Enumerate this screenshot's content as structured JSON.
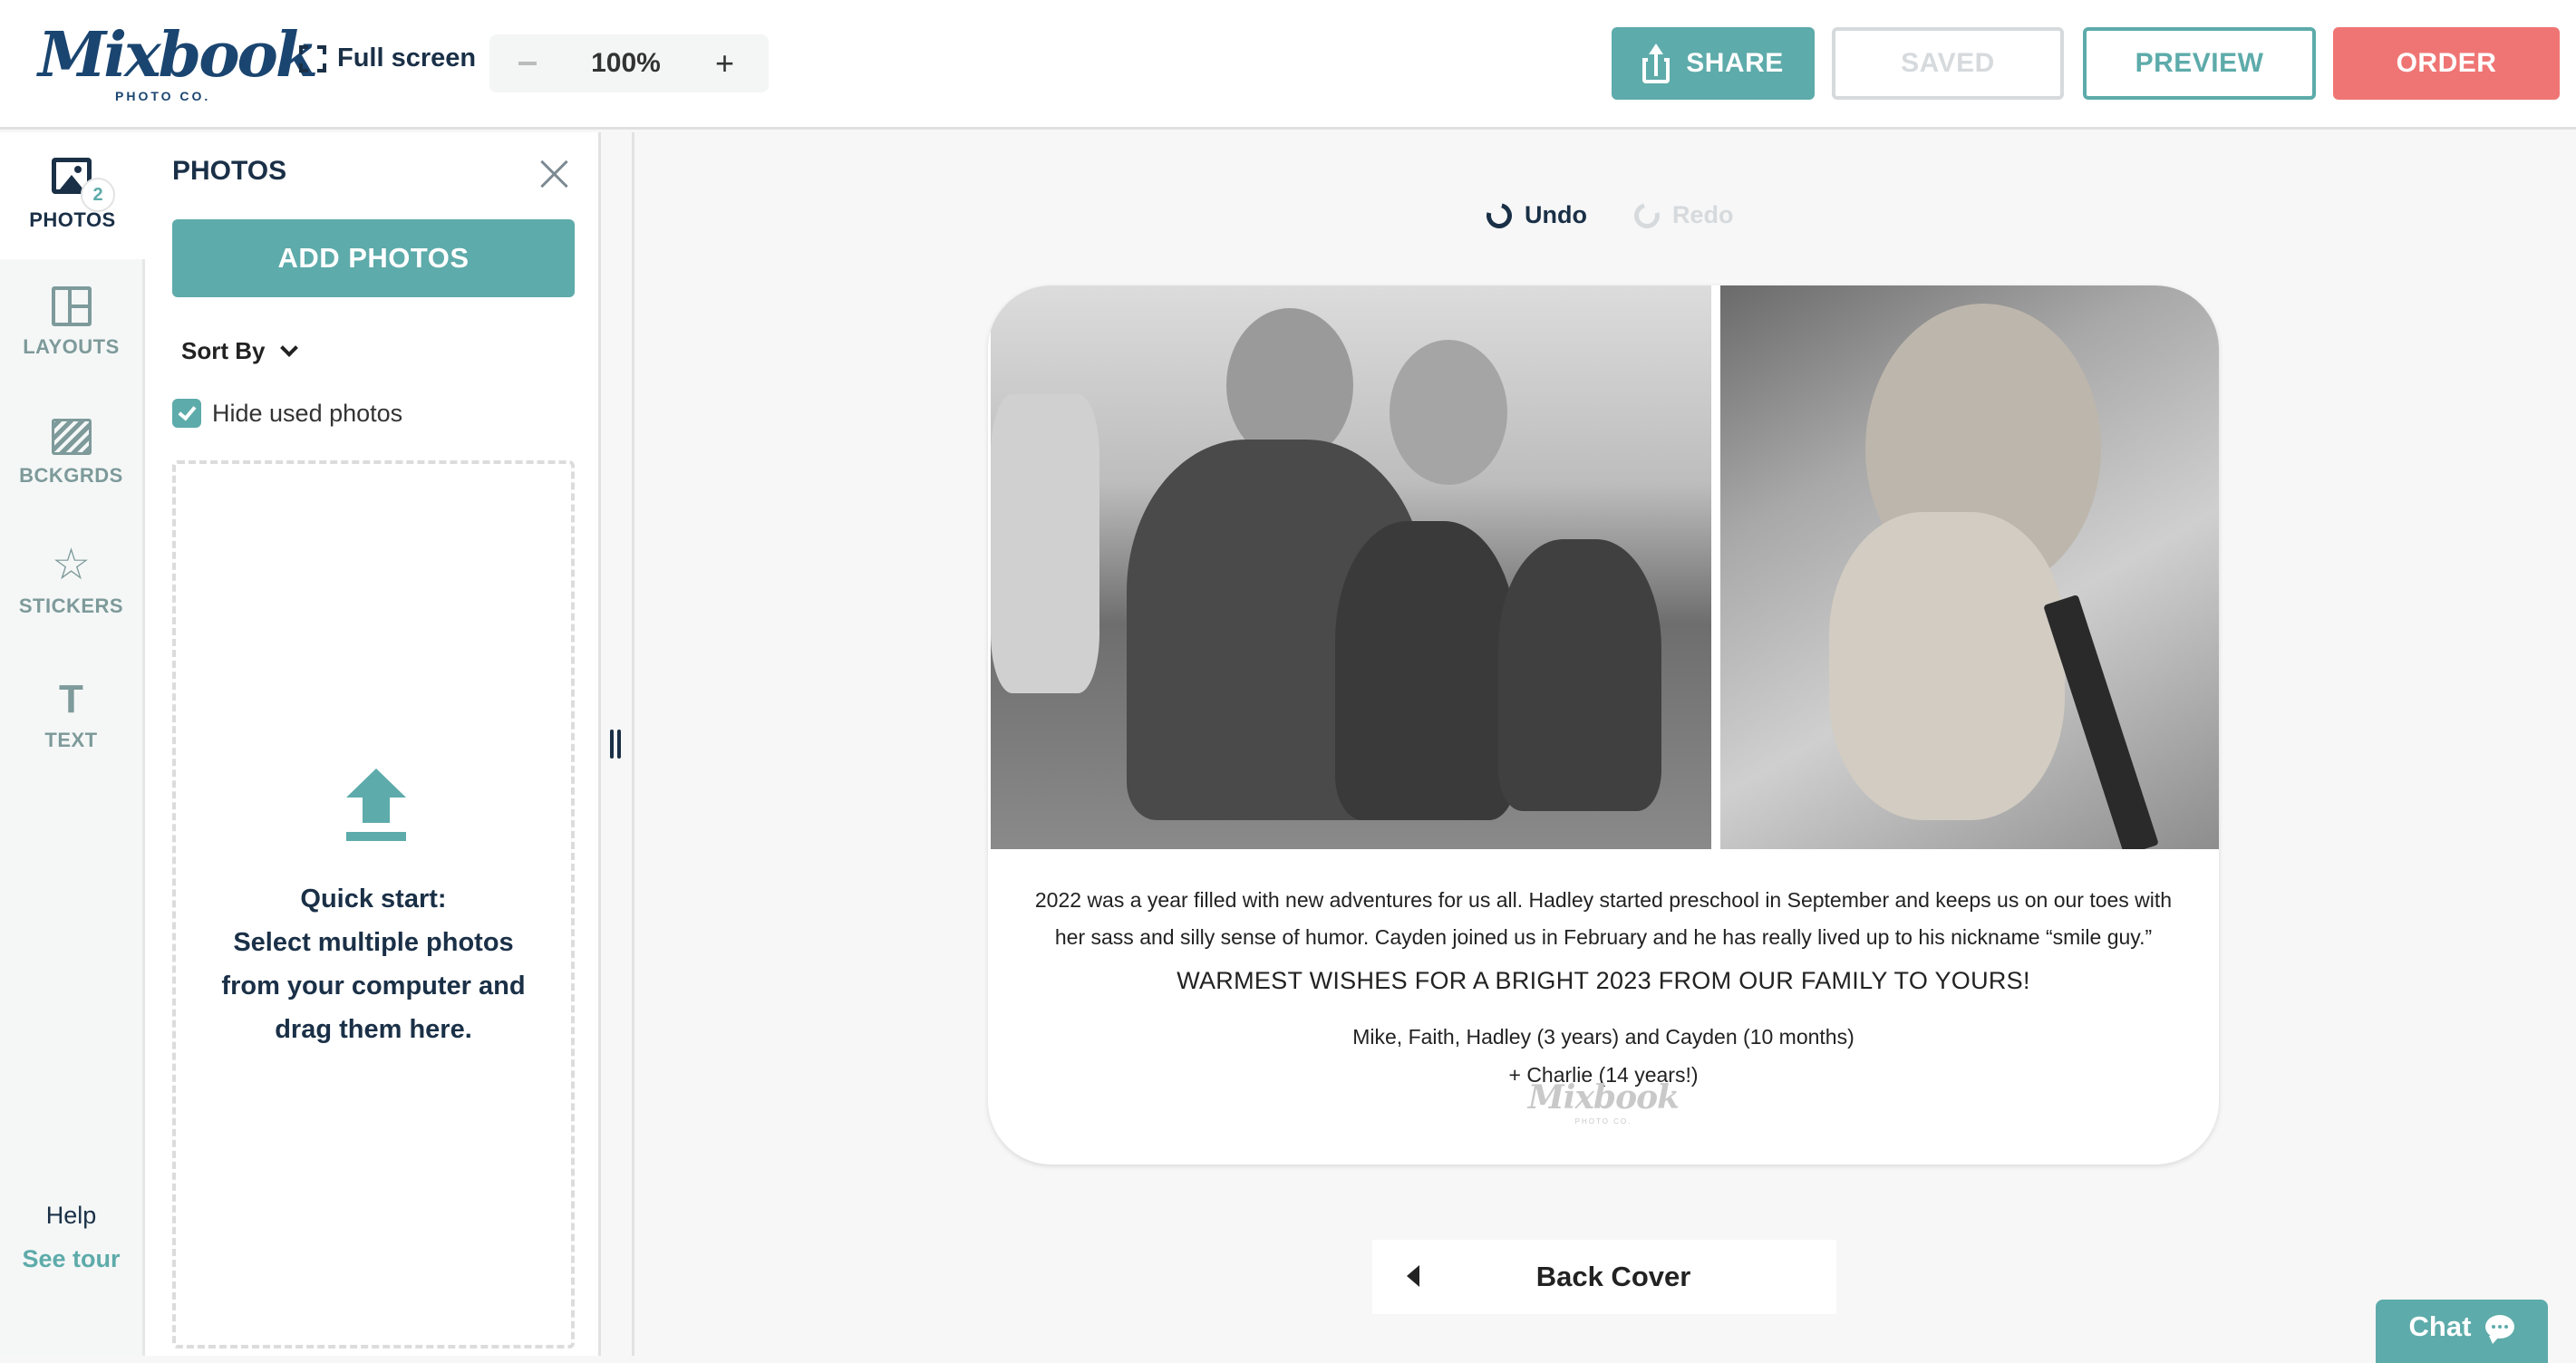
{
  "header": {
    "logo": {
      "name": "Mixbook",
      "sub": "PHOTO CO."
    },
    "fullscreen_label": "Full screen",
    "zoom": {
      "minus": "–",
      "value": "100%",
      "plus": "+"
    },
    "buttons": {
      "share": "SHARE",
      "saved": "SAVED",
      "preview": "PREVIEW",
      "order": "ORDER"
    }
  },
  "colors": {
    "accent": "#5dabaa",
    "order": "#ef7574",
    "navy": "#1a3047",
    "muted": "#7e9a9a"
  },
  "rail": {
    "items": [
      {
        "label": "PHOTOS",
        "icon": "image-icon",
        "badge": "2",
        "active": true
      },
      {
        "label": "LAYOUTS",
        "icon": "layout-icon"
      },
      {
        "label": "BCKGRDS",
        "icon": "background-icon"
      },
      {
        "label": "STICKERS",
        "icon": "star-icon"
      },
      {
        "label": "TEXT",
        "icon": "text-icon",
        "glyph": "T"
      }
    ],
    "help": "Help",
    "tour": "See tour"
  },
  "panel": {
    "title": "PHOTOS",
    "add_button": "ADD PHOTOS",
    "sort_label": "Sort By",
    "hide_used_label": "Hide used photos",
    "hide_used_checked": true,
    "quick_start": [
      "Quick start:",
      "Select multiple photos",
      "from your computer and",
      "drag them here."
    ]
  },
  "canvas": {
    "undo": "Undo",
    "redo": "Redo",
    "card": {
      "photos": [
        {
          "alt": "Family of four on a couch (black and white)"
        },
        {
          "alt": "Pug dog resting on a chair (black and white)"
        }
      ],
      "body_lines": [
        "2022 was a year filled with new adventures for us all. Hadley started preschool in September and keeps us on our toes with",
        "her sass and silly sense of humor. Cayden joined us in February and he has really lived up to his nickname “smile guy.”"
      ],
      "wishes": "WARMEST WISHES FOR A BRIGHT 2023 FROM OUR FAMILY TO YOURS!",
      "names_lines": [
        "Mike, Faith, Hadley (3 years) and Cayden (10 months)",
        "+ Charlie (14 years!)"
      ],
      "watermark": "Mixbook",
      "watermark_sub": "PHOTO CO."
    },
    "page_nav": {
      "label": "Back Cover"
    }
  },
  "chat": {
    "label": "Chat"
  }
}
